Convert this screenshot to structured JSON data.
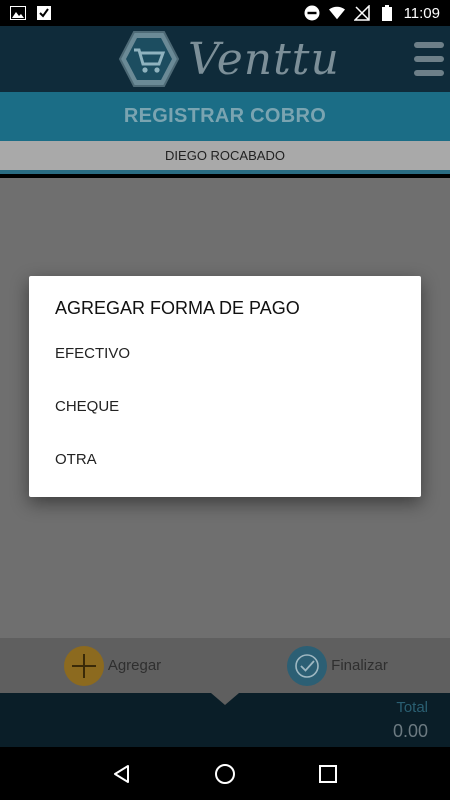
{
  "status_bar": {
    "time": "11:09",
    "icons": [
      "image-icon",
      "check-box-icon",
      "do-not-disturb-icon",
      "wifi-icon",
      "no-sim-icon",
      "battery-icon"
    ]
  },
  "header": {
    "logo_text": "Venttu",
    "menu_icon": "hamburger-menu-icon"
  },
  "page": {
    "title": "REGISTRAR COBRO",
    "client_name": "DIEGO ROCABADO"
  },
  "actions": {
    "add_label": "Agregar",
    "finish_label": "Finalizar"
  },
  "footer": {
    "total_label": "Total",
    "total_value": "0.00"
  },
  "dialog": {
    "title": "AGREGAR FORMA DE PAGO",
    "options": [
      "EFECTIVO",
      "CHEQUE",
      "OTRA"
    ]
  },
  "nav": {
    "icons": [
      "back-icon",
      "home-icon",
      "recents-icon"
    ]
  },
  "colors": {
    "header_bg": "#0f2b3a",
    "title_bg": "#1b6d86",
    "accent_add": "#e0a93a",
    "accent_finish": "#3f8db0"
  }
}
